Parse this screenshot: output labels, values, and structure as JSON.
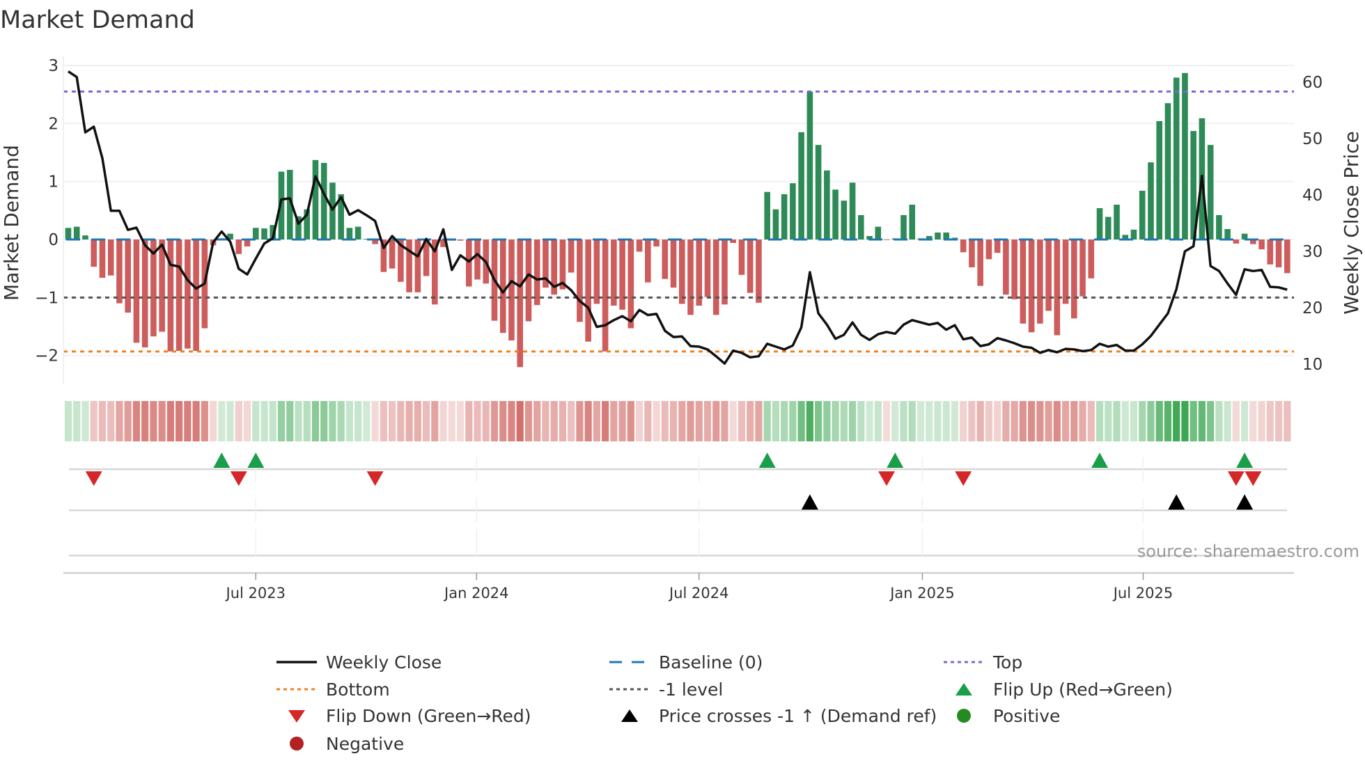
{
  "title": "Market Demand",
  "source": "source: sharemaestro.com",
  "chart_data": {
    "type": "bar+line",
    "title": "Market Demand",
    "ylabel": "Market Demand",
    "y2label": "Weekly Close Price",
    "ylim": [
      -2.5,
      3.17
    ],
    "y2lim": [
      6,
      64
    ],
    "yticks": [
      {
        "v": 3,
        "label": "3"
      },
      {
        "v": 2,
        "label": "2"
      },
      {
        "v": 1,
        "label": "1"
      },
      {
        "v": 0,
        "label": "0"
      },
      {
        "v": -1,
        "label": "−1"
      },
      {
        "v": -2,
        "label": "−2"
      }
    ],
    "y2ticks": [
      {
        "v": 60,
        "label": "60"
      },
      {
        "v": 50,
        "label": "50"
      },
      {
        "v": 40,
        "label": "40"
      },
      {
        "v": 30,
        "label": "30"
      },
      {
        "v": 20,
        "label": "20"
      },
      {
        "v": 10,
        "label": "10"
      }
    ],
    "xticks": [
      {
        "label": "Jul 2023",
        "week": 23
      },
      {
        "label": "Jan 2024",
        "week": 48.9
      },
      {
        "label": "Jul 2024",
        "week": 75
      },
      {
        "label": "Jan 2025",
        "week": 101.2
      },
      {
        "label": "Jul 2025",
        "week": 127.1
      }
    ],
    "grid": true,
    "levels": {
      "top": 2.55,
      "baseline": 0,
      "minus_one": -1,
      "bottom": -1.93
    },
    "demand": [
      0.2,
      0.22,
      0.07,
      -0.47,
      -0.66,
      -0.62,
      -1.1,
      -1.26,
      -1.78,
      -1.86,
      -1.67,
      -1.59,
      -1.93,
      -1.92,
      -1.88,
      -1.92,
      -1.53,
      -0.1,
      0.02,
      0.1,
      -0.25,
      -0.12,
      0.2,
      0.19,
      0.25,
      1.17,
      1.2,
      0.4,
      0.52,
      1.37,
      1.32,
      0.98,
      0.78,
      0.2,
      0.22,
      0.01,
      -0.08,
      -0.56,
      -0.5,
      -0.73,
      -0.91,
      -0.91,
      -0.63,
      -1.12,
      -0.13,
      -0.02,
      -0.02,
      -0.81,
      -0.69,
      -0.76,
      -1.4,
      -1.61,
      -1.74,
      -2.2,
      -1.41,
      -1.13,
      -0.83,
      -0.95,
      -0.86,
      -0.57,
      -1.42,
      -1.76,
      -1.11,
      -1.93,
      -1.14,
      -1.21,
      -1.53,
      -0.21,
      -0.74,
      -0.12,
      -0.68,
      -0.83,
      -1.11,
      -1.3,
      -1.14,
      -0.99,
      -1.3,
      -1.12,
      -0.06,
      -0.61,
      -0.92,
      -1.09,
      0.82,
      0.52,
      0.78,
      0.97,
      1.85,
      2.55,
      1.63,
      1.19,
      0.86,
      0.67,
      0.98,
      0.42,
      0.06,
      0.22,
      -0.01,
      0.02,
      0.42,
      0.6,
      0.02,
      0.06,
      0.12,
      0.12,
      0.03,
      -0.22,
      -0.48,
      -0.8,
      -0.34,
      -0.23,
      -0.95,
      -1.03,
      -1.45,
      -1.6,
      -1.45,
      -1.23,
      -1.65,
      -1.11,
      -1.36,
      -0.98,
      -0.67,
      0.54,
      0.39,
      0.6,
      0.08,
      0.17,
      0.84,
      1.33,
      2.04,
      2.35,
      2.79,
      2.87,
      1.87,
      2.09,
      1.63,
      0.42,
      0.18,
      -0.07,
      0.1,
      -0.08,
      -0.17,
      -0.43,
      -0.48,
      -0.58
    ],
    "weekly_close": [
      61.9,
      60.9,
      51.1,
      52.1,
      46.5,
      37.2,
      37.2,
      33.8,
      34.2,
      31.1,
      29.6,
      31.2,
      27.6,
      27.3,
      24.9,
      23.4,
      24.3,
      31.6,
      33.5,
      31.7,
      26.9,
      25.9,
      28.7,
      31.4,
      32.3,
      39.2,
      39.4,
      34.9,
      36.5,
      43.3,
      40.2,
      37.4,
      39.6,
      36.5,
      37.3,
      36.4,
      35.4,
      30.6,
      32.7,
      31.1,
      30.1,
      29.1,
      32.2,
      30,
      33.9,
      26.7,
      29.3,
      28.2,
      29.5,
      28.1,
      24.9,
      22.7,
      24.7,
      23.8,
      25.9,
      25,
      25.2,
      23.7,
      24.4,
      23.1,
      21.2,
      20,
      16.6,
      16.9,
      17.8,
      18.5,
      17.6,
      19.6,
      18.7,
      18.9,
      15.9,
      14.8,
      14.9,
      13.2,
      13.1,
      12.6,
      11.4,
      10.1,
      12.4,
      12,
      11.2,
      11.4,
      13.6,
      13.1,
      12.6,
      13.3,
      16.5,
      26.3,
      19,
      17,
      14.5,
      15.2,
      17.4,
      15.2,
      14.3,
      15.3,
      15.7,
      15.4,
      17,
      17.8,
      17.4,
      17,
      17.3,
      16.1,
      16.9,
      14.4,
      14.7,
      13.2,
      13.5,
      14.6,
      14.2,
      13.7,
      13.1,
      12.9,
      12,
      12.5,
      12.1,
      12.7,
      12.6,
      12.3,
      12.5,
      13.6,
      13.1,
      13.4,
      12.4,
      12.4,
      13.5,
      15,
      17,
      19,
      23.3,
      30,
      30.9,
      43.4,
      27.4,
      26.5,
      24.3,
      22.3,
      26.8,
      26.5,
      26.7,
      23.7,
      23.6,
      23.2
    ],
    "flip_up_weeks": [
      19,
      23,
      83,
      98,
      122,
      139
    ],
    "flip_down_weeks": [
      4,
      21,
      37,
      97,
      106,
      138,
      140
    ],
    "price_cross_weeks": [
      88,
      131,
      139
    ],
    "legend": [
      {
        "key": "weekly_close",
        "label": "Weekly Close"
      },
      {
        "key": "baseline",
        "label": "Baseline (0)"
      },
      {
        "key": "top",
        "label": "Top"
      },
      {
        "key": "bottom",
        "label": "Bottom"
      },
      {
        "key": "minus_one",
        "label": "-1 level"
      },
      {
        "key": "flip_up",
        "label": "Flip Up (Red→Green)"
      },
      {
        "key": "flip_down",
        "label": "Flip Down (Green→Red)"
      },
      {
        "key": "price_cross",
        "label": "Price crosses -1 ↑ (Demand ref)"
      },
      {
        "key": "positive",
        "label": "Positive"
      },
      {
        "key": "negative",
        "label": "Negative"
      }
    ],
    "colors": {
      "positive": "#2e8b57",
      "negative": "#cd5c5c",
      "price": "#111111",
      "baseline": "#1f77b4",
      "top": "#7b68d8",
      "bottom": "#f0821e",
      "minus_one": "#555555",
      "flip_up": "#1a9e4a",
      "flip_down": "#d62728",
      "price_cross": "#000000",
      "positive_dot": "#228b22",
      "negative_dot": "#b22222"
    }
  }
}
